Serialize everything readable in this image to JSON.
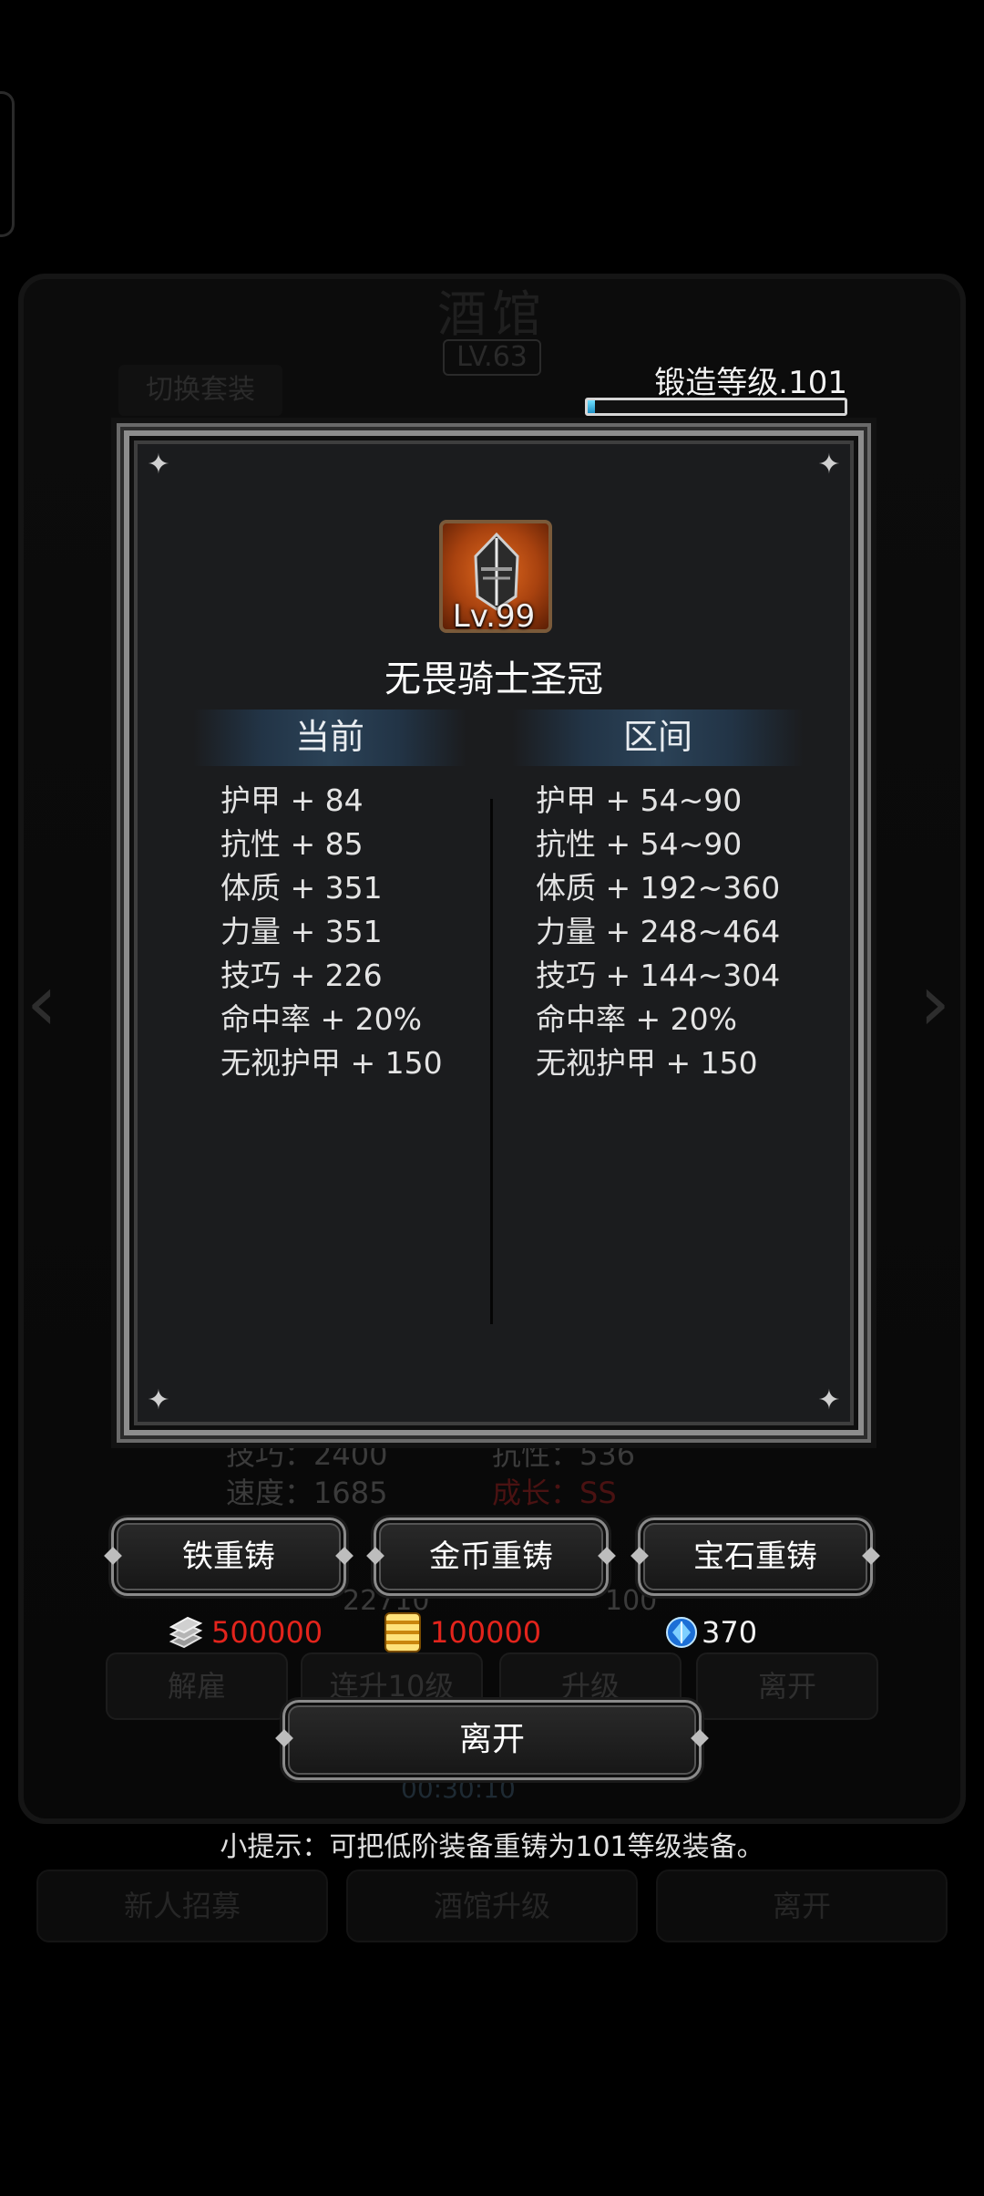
{
  "background": {
    "title": "酒馆",
    "level": "LV.63",
    "switch_outfit": "切换套装",
    "stats": {
      "skill": "技巧：2400",
      "resistance": "抗性：536",
      "speed": "速度：1685",
      "growth": "成长：SS",
      "value_a": "22710",
      "value_b": "100"
    },
    "buttons": [
      "解雇",
      "连升10级",
      "升级",
      "离开"
    ],
    "timer": "00:30:10",
    "bottom_buttons": [
      "新人招募",
      "酒馆升级",
      "离开"
    ]
  },
  "forge": {
    "label": "锻造等级.101",
    "progress": 0.03
  },
  "item": {
    "level": "Lv.99",
    "name": "无畏骑士圣冠"
  },
  "columns": {
    "current_header": "当前",
    "range_header": "区间"
  },
  "current_stats": [
    "护甲 + 84",
    "抗性 + 85",
    "体质 + 351",
    "力量 + 351",
    "技巧 + 226",
    "命中率 + 20%",
    "无视护甲 + 150"
  ],
  "range_stats": [
    "护甲 + 54~90",
    "抗性 + 54~90",
    "体质 + 192~360",
    "力量 + 248~464",
    "技巧 + 144~304",
    "命中率 + 20%",
    "无视护甲 + 150"
  ],
  "reforge": {
    "iron_label": "铁重铸",
    "gold_label": "金币重铸",
    "gem_label": "宝石重铸"
  },
  "costs": {
    "iron": "500000",
    "gold": "100000",
    "gem": "370"
  },
  "leave_label": "离开",
  "tip": "小提示：可把低阶装备重铸为101等级装备。",
  "colors": {
    "cost_red": "#e3241c",
    "progress_fill": "#1e8fc4"
  }
}
